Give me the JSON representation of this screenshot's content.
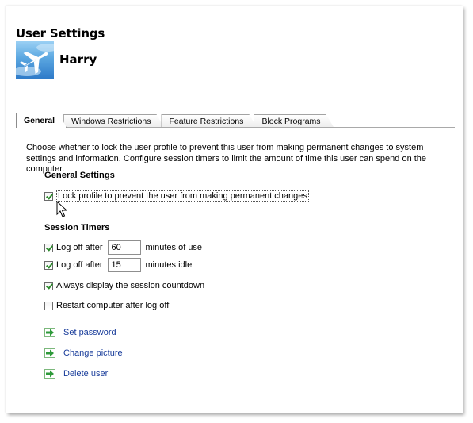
{
  "header": {
    "title": "User Settings",
    "username": "Harry"
  },
  "tabs": [
    {
      "label": "General",
      "active": true
    },
    {
      "label": "Windows Restrictions",
      "active": false
    },
    {
      "label": "Feature Restrictions",
      "active": false
    },
    {
      "label": "Block Programs",
      "active": false
    }
  ],
  "description": "Choose whether to lock the user profile to prevent this user from making permanent changes to system settings and information. Configure session timers to limit the amount of time this user can spend on the computer.",
  "general_settings": {
    "heading": "General Settings",
    "lock_profile": {
      "label": "Lock profile to prevent the user from making permanent changes",
      "checked": true
    }
  },
  "session_timers": {
    "heading": "Session Timers",
    "log_off_use": {
      "label": "Log off after",
      "value": "60",
      "suffix": "minutes of use",
      "checked": true
    },
    "log_off_idle": {
      "label": "Log off after",
      "value": "15",
      "suffix": "minutes idle",
      "checked": true
    },
    "countdown": {
      "label": "Always display the session countdown",
      "checked": true
    },
    "restart": {
      "label": "Restart computer after log off",
      "checked": false
    }
  },
  "actions": [
    {
      "label": "Set password",
      "icon": "green-arrow-icon"
    },
    {
      "label": "Change picture",
      "icon": "green-arrow-icon"
    },
    {
      "label": "Delete user",
      "icon": "green-arrow-icon"
    }
  ],
  "colors": {
    "link": "#173b9a",
    "check": "#2b8a2b",
    "arrow": "#2e9a3a"
  }
}
